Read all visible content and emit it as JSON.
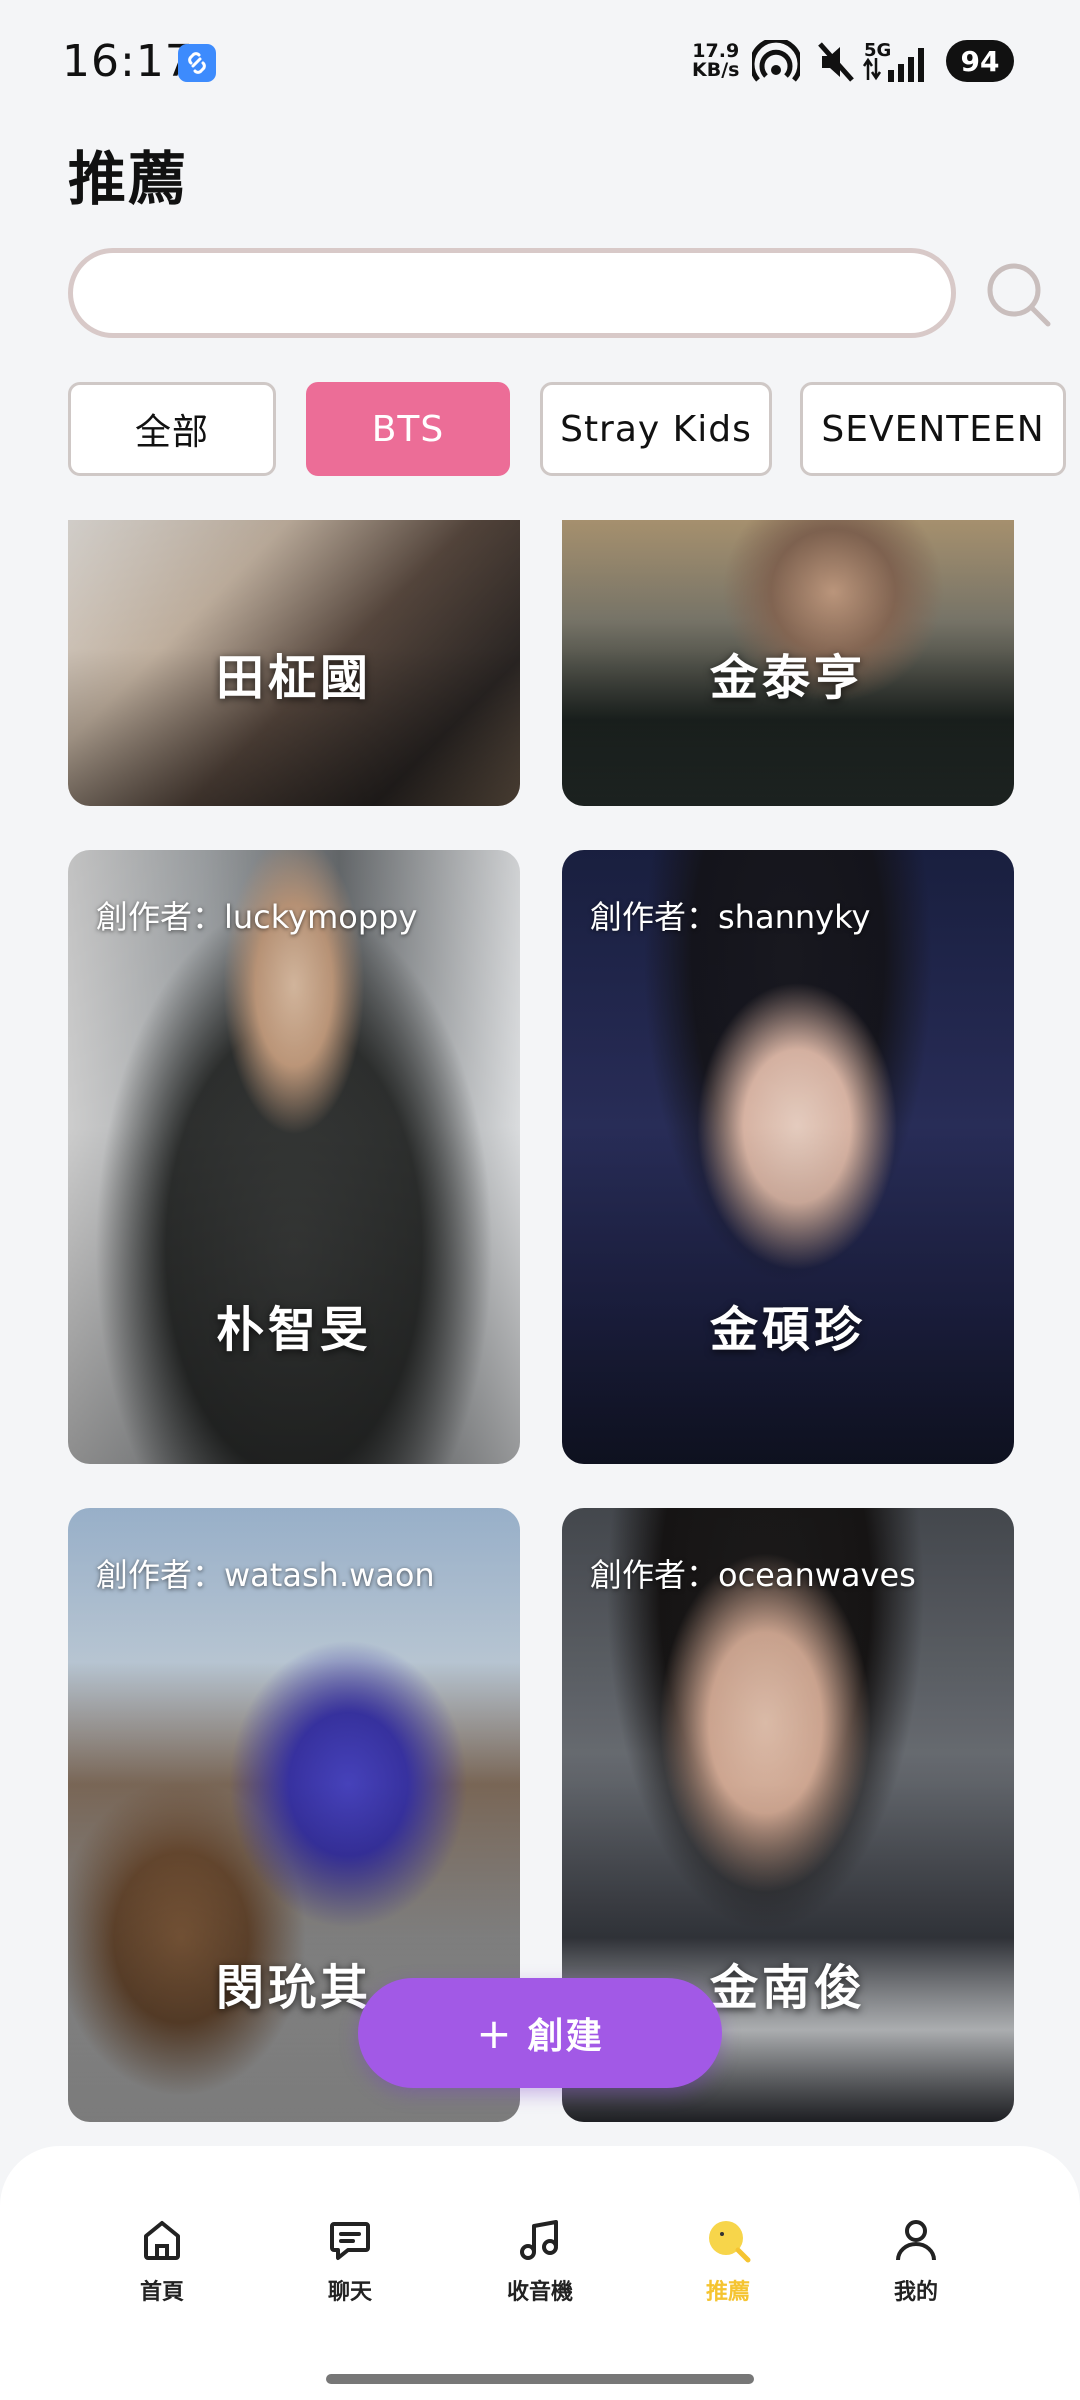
{
  "status_bar": {
    "time": "16:17",
    "net_speed_value": "17.9",
    "net_speed_unit": "KB/s",
    "network": "5G",
    "battery": "94",
    "icons": [
      "link-app-icon",
      "hotspot-icon",
      "mute-icon",
      "signal-icon"
    ]
  },
  "page": {
    "title": "推薦"
  },
  "search": {
    "value": "",
    "placeholder": ""
  },
  "filters": [
    {
      "label": "全部",
      "active": false
    },
    {
      "label": "BTS",
      "active": true
    },
    {
      "label": "Stray Kids",
      "active": false
    },
    {
      "label": "SEVENTEEN",
      "active": false
    }
  ],
  "cards": [
    {
      "name": "田柾國",
      "creator": ""
    },
    {
      "name": "金泰亨",
      "creator": ""
    },
    {
      "name": "朴智旻",
      "creator": "創作者：luckymoppy"
    },
    {
      "name": "金碩珍",
      "creator": "創作者：shannyky"
    },
    {
      "name": "閔玧其",
      "creator": "創作者：watash.waon"
    },
    {
      "name": "金南俊",
      "creator": "創作者：oceanwaves"
    }
  ],
  "create_button": {
    "plus": "+",
    "label": "創建"
  },
  "nav": [
    {
      "label": "首頁",
      "icon": "home-icon",
      "active": false
    },
    {
      "label": "聊天",
      "icon": "chat-icon",
      "active": false
    },
    {
      "label": "收音機",
      "icon": "music-icon",
      "active": false
    },
    {
      "label": "推薦",
      "icon": "recommend-icon",
      "active": true
    },
    {
      "label": "我的",
      "icon": "profile-icon",
      "active": false
    }
  ],
  "colors": {
    "accent_pink": "#ec6d97",
    "create_purple": "#a259e6",
    "active_nav_yellow": "#f5c431"
  }
}
